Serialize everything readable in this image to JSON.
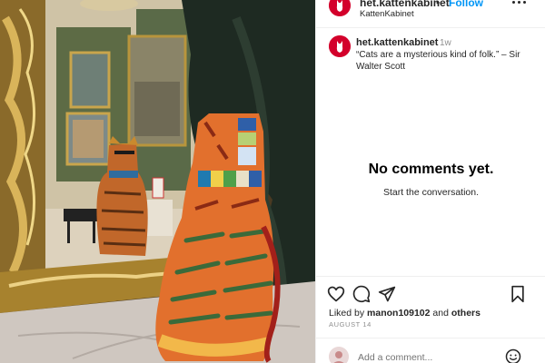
{
  "post": {
    "image_alt": "Ceramic tiger-striped cat statue in front of a gilded mirror in an ornate room",
    "header": {
      "username": "het.kattenkabinet",
      "separator": "•",
      "follow_label": "Follow",
      "subtitle": "KattenKabinet"
    },
    "caption": {
      "username": "het.kattenkabinet",
      "time": "1w",
      "text": "“Cats are a mysterious kind of folk.” – Sir Walter Scott"
    },
    "empty_state": {
      "title": "No comments yet.",
      "subtitle": "Start the conversation."
    },
    "actions": {
      "like_icon": "heart-icon",
      "comment_icon": "comment-icon",
      "share_icon": "share-icon",
      "save_icon": "bookmark-icon"
    },
    "likes": {
      "prefix": "Liked by",
      "user": "manon109102",
      "connector": "and",
      "others": "others"
    },
    "date": "August 14",
    "add_comment": {
      "placeholder": "Add a comment..."
    }
  },
  "colors": {
    "brand_red": "#d3002b",
    "follow_blue": "#0095f6",
    "text": "#262626",
    "muted": "#8e8e8e",
    "divider": "#efefef"
  }
}
